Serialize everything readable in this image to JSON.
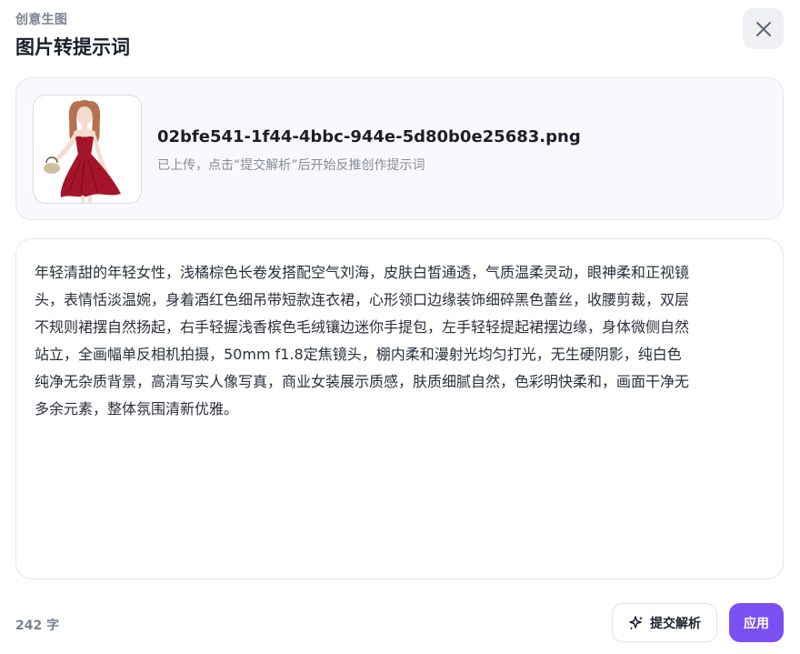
{
  "header": {
    "subtitle": "创意生图",
    "title": "图片转提示词"
  },
  "upload": {
    "file_name": "02bfe541-1f44-4bbc-944e-5d80b0e25683.png",
    "hint": "已上传，点击“提交解析”后开始反推创作提示词"
  },
  "prompt": {
    "text": "年轻清甜的年轻女性，浅橘棕色长卷发搭配空气刘海，皮肤白皙通透，气质温柔灵动，眼神柔和正视镜头，表情恬淡温婉，身着酒红色细吊带短款连衣裙，心形领口边缘装饰细碎黑色蕾丝，收腰剪裁，双层不规则裙摆自然扬起，右手轻握浅香槟色毛绒镶边迷你手提包，左手轻轻提起裙摆边缘，身体微侧自然站立，全画幅单反相机拍摄，50mm f1.8定焦镜头，棚内柔和漫射光均匀打光，无生硬阴影，纯白色纯净无杂质背景，高清写实人像写真，商业女装展示质感，肤质细腻自然，色彩明快柔和，画面干净无多余元素，整体氛围清新优雅。"
  },
  "footer": {
    "char_count": "242 字",
    "submit_label": "提交解析",
    "apply_label": "应用"
  },
  "icons": {
    "close": "close-icon",
    "submit": "sparkle-icon",
    "thumbnail": "image-thumbnail"
  },
  "colors": {
    "accent": "#7c4ff0",
    "dress": "#a5152a",
    "hair": "#b5724f"
  }
}
